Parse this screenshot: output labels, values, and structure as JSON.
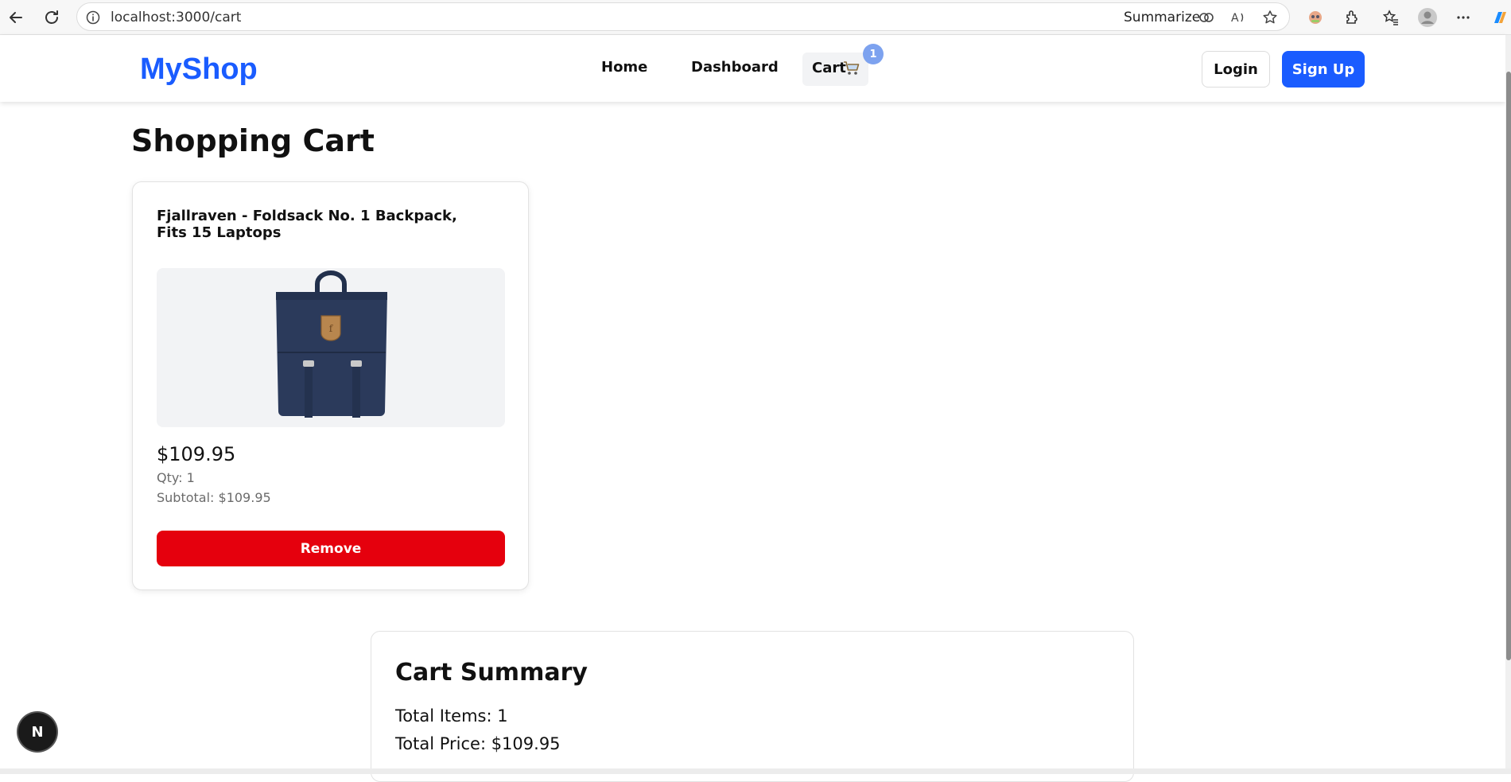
{
  "browser": {
    "url": "localhost:3000/cart",
    "summarize_label": "Summarize"
  },
  "nav": {
    "brand": "MyShop",
    "links": [
      "Home",
      "Dashboard"
    ],
    "cart_label": "Cart",
    "cart_count": "1",
    "login_label": "Login",
    "signup_label": "Sign Up"
  },
  "page": {
    "title": "Shopping Cart"
  },
  "cart_item": {
    "title": "Fjallraven - Foldsack No. 1 Backpack, Fits 15 Laptops",
    "price": "$109.95",
    "qty": "Qty: 1",
    "subtotal": "Subtotal: $109.95",
    "remove_label": "Remove"
  },
  "summary": {
    "title": "Cart Summary",
    "total_items": "Total Items: 1",
    "total_price": "Total Price: $109.95"
  },
  "colors": {
    "brand": "#1a5cff",
    "danger": "#e5000d",
    "badge": "#7da2ef"
  },
  "icons": [
    "back-icon",
    "reload-icon",
    "info-icon",
    "copilot-icon",
    "read-aloud-icon",
    "favorite-star-icon",
    "extension-avatar-icon",
    "extensions-icon",
    "favorites-icon",
    "profile-icon",
    "more-icon",
    "cart-icon",
    "nextjs-icon"
  ]
}
